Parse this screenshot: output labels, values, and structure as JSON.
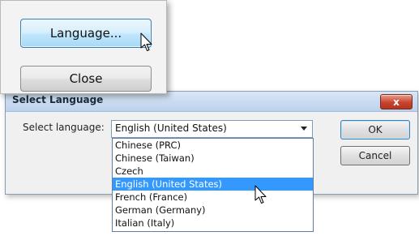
{
  "launcher": {
    "language_button": "Language...",
    "close_button": "Close"
  },
  "dialog": {
    "title": "Select Language",
    "close_glyph": "x",
    "select_label": "Select language:",
    "select_value": "English (United States)",
    "options": [
      "Chinese (PRC)",
      "Chinese (Taiwan)",
      "Czech",
      "English (United States)",
      "French (France)",
      "German (Germany)",
      "Italian (Italy)"
    ],
    "selected_option": "English (United States)",
    "ok_button": "OK",
    "cancel_button": "Cancel"
  },
  "colors": {
    "selection": "#3399ff",
    "close_button_red": "#c8442f",
    "focus_blue": "#3c7fb1"
  },
  "icons": {
    "cursor": "arrow-cursor-icon",
    "dropdown": "chevron-down-icon",
    "close": "close-icon"
  }
}
